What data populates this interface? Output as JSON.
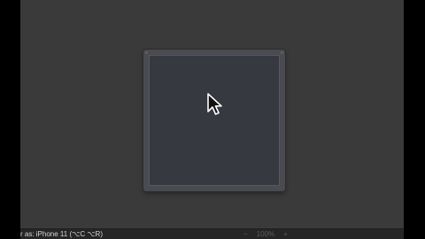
{
  "status_bar": {
    "preview_label": "r as: iPhone 11 (⌥C ⌥R)",
    "zoom_out_glyph": "−",
    "zoom_level": "100%",
    "zoom_in_glyph": "+"
  },
  "icons": {
    "cursor": "arrow-cursor-icon",
    "zoom_out": "minus-icon",
    "zoom_in": "plus-icon"
  },
  "colors": {
    "canvas_background": "#3a3a3a",
    "device_screen": "#363940",
    "device_frame": "#4a4b50"
  }
}
